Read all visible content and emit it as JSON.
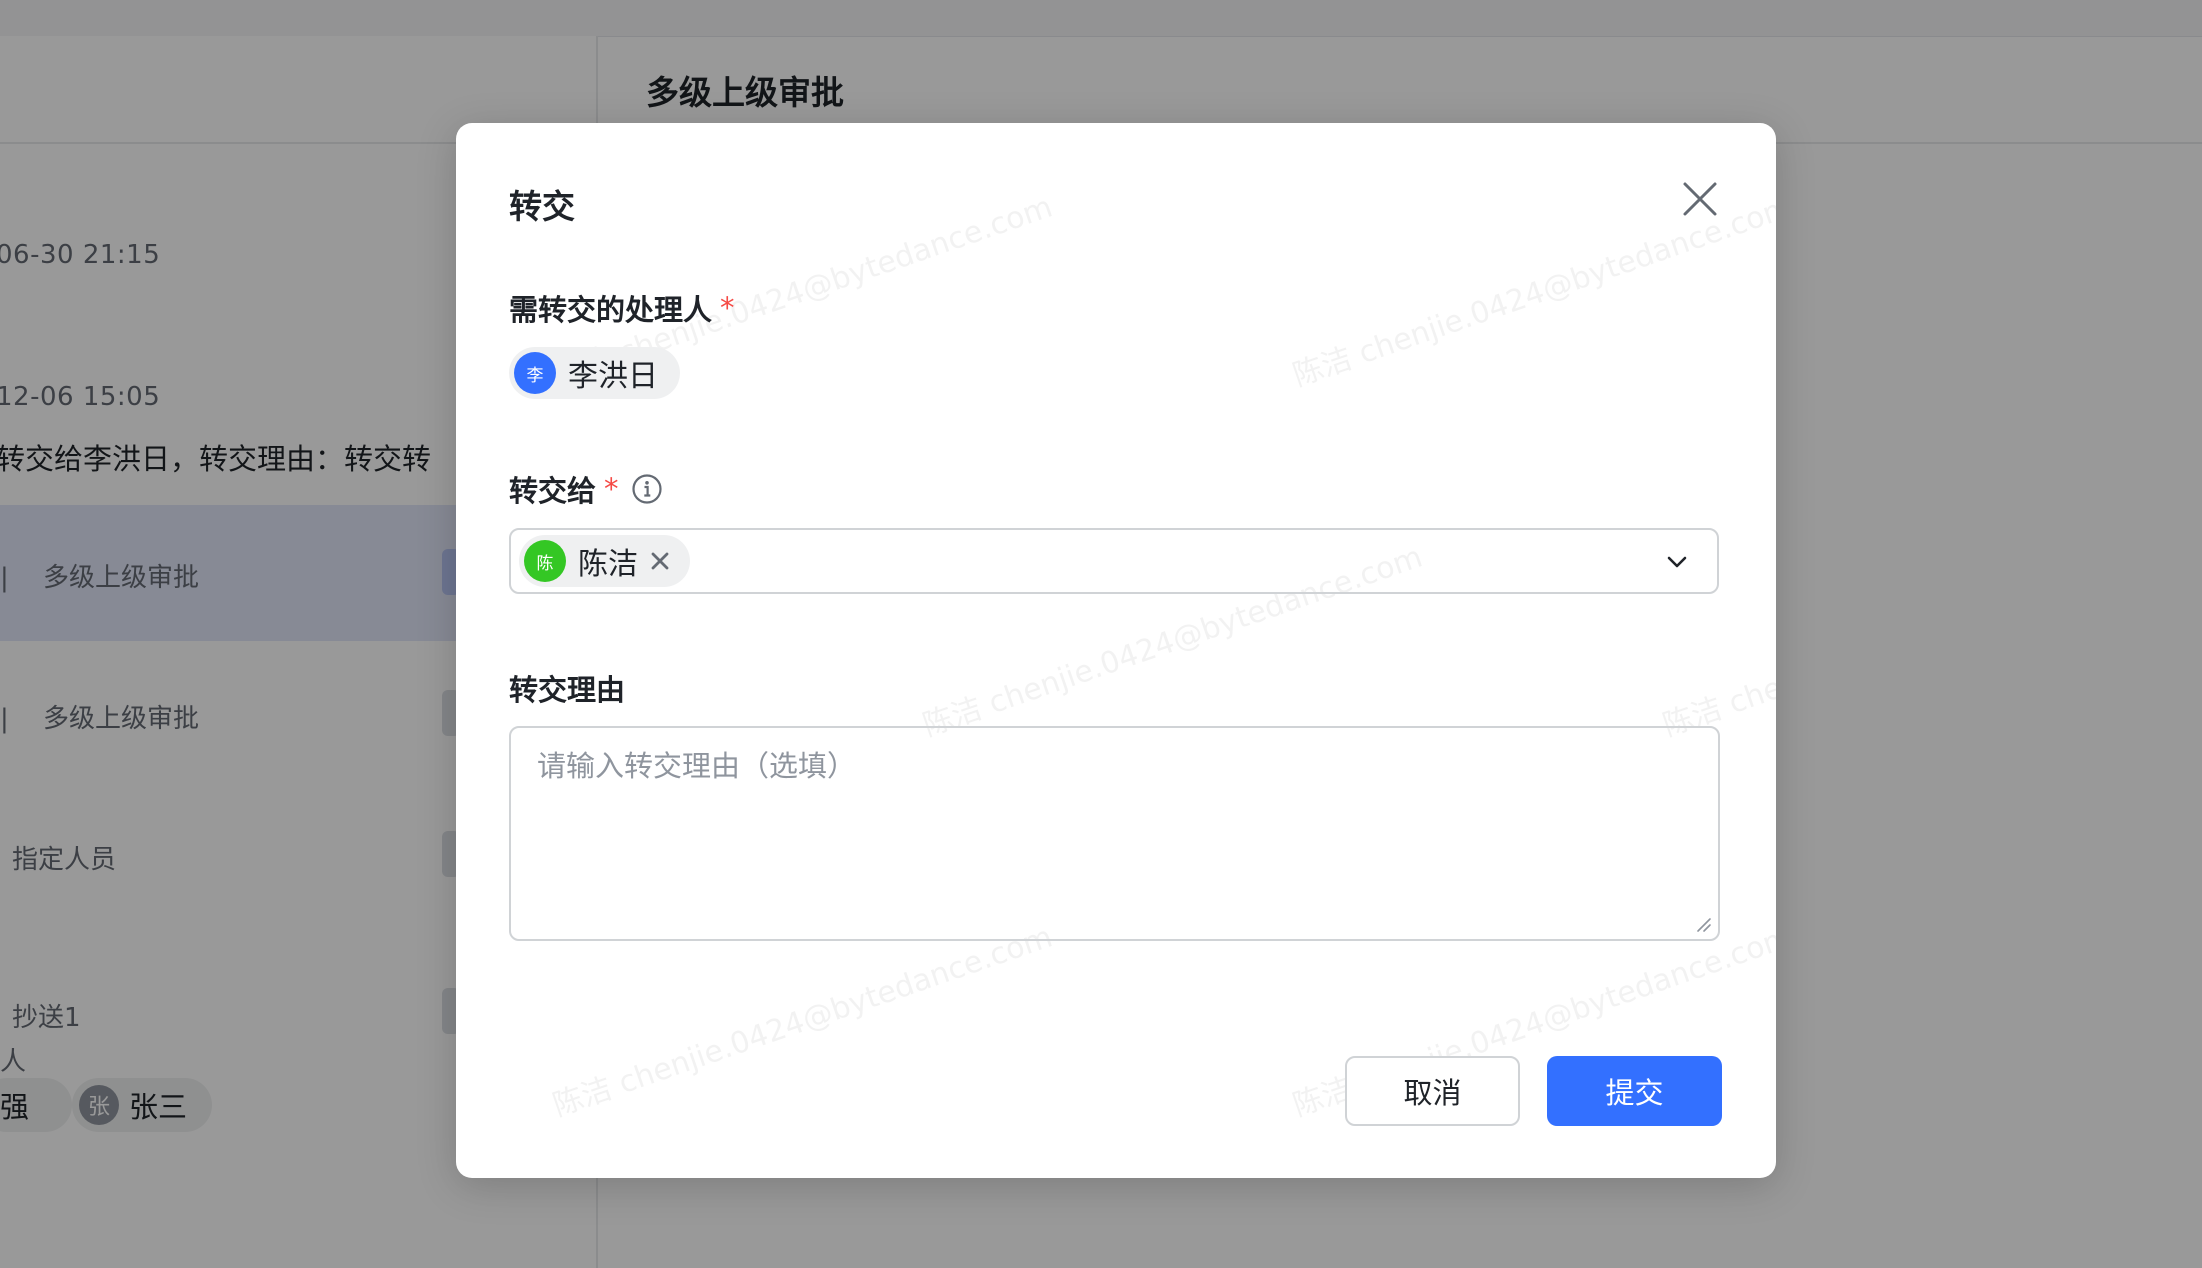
{
  "background": {
    "page_title": "多级上级审批",
    "timeline": [
      {
        "time": "06-30 21:15"
      },
      {
        "time": "12-06 15:05",
        "text": "转交给李洪日，转交理由：转交转"
      }
    ],
    "nodes": [
      {
        "prefix": "",
        "label": "多级上级审批"
      },
      {
        "prefix": "",
        "label": "多级上级审批"
      },
      {
        "prefix": "",
        "label": "指定人员"
      },
      {
        "prefix": "",
        "label": "抄送1",
        "sub": "人"
      }
    ],
    "people": [
      {
        "name": "强"
      },
      {
        "avatar": "张",
        "name": "张三"
      }
    ]
  },
  "modal": {
    "title": "转交",
    "close_icon": "close-icon",
    "from_label": "需转交的处理人",
    "required_mark": "*",
    "from_person": {
      "avatar": "李",
      "name": "李洪日",
      "avatar_color": "#3370ff"
    },
    "to_label": "转交给",
    "to_person": {
      "avatar": "陈",
      "name": "陈洁",
      "avatar_color": "#34c724"
    },
    "reason_label": "转交理由",
    "reason_placeholder": "请输入转交理由（选填）",
    "cancel_label": "取消",
    "submit_label": "提交",
    "accent_color": "#3370ff",
    "watermark": "陈洁 chenjie.0424@bytedance.com"
  }
}
